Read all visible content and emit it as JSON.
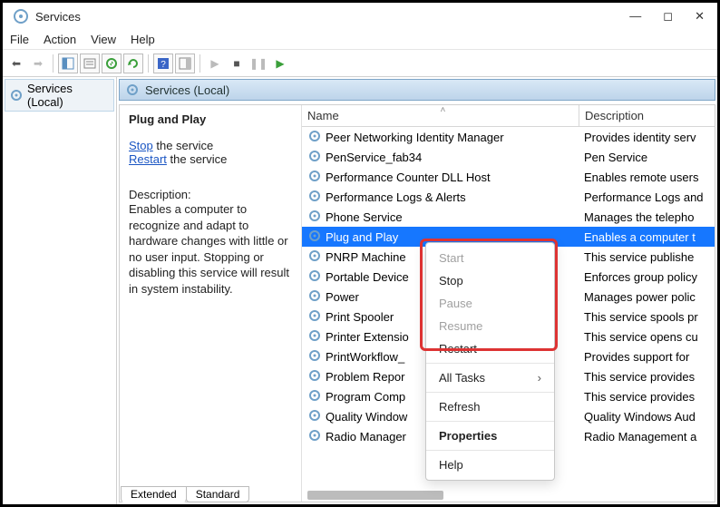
{
  "window": {
    "title": "Services"
  },
  "menubar": {
    "file": "File",
    "action": "Action",
    "view": "View",
    "help": "Help"
  },
  "tree": {
    "root": "Services (Local)"
  },
  "pane_header": "Services (Local)",
  "detail": {
    "service_name": "Plug and Play",
    "stop_link": "Stop",
    "stop_suffix": " the service",
    "restart_link": "Restart",
    "restart_suffix": " the service",
    "desc_label": "Description:",
    "description": "Enables a computer to recognize and adapt to hardware changes with little or no user input. Stopping or disabling this service will result in system instability."
  },
  "columns": {
    "name": "Name",
    "description": "Description"
  },
  "services": [
    {
      "name": "Peer Networking Identity Manager",
      "desc": "Provides identity serv"
    },
    {
      "name": "PenService_fab34",
      "desc": "Pen Service"
    },
    {
      "name": "Performance Counter DLL Host",
      "desc": "Enables remote users"
    },
    {
      "name": "Performance Logs & Alerts",
      "desc": "Performance Logs and"
    },
    {
      "name": "Phone Service",
      "desc": "Manages the telepho"
    },
    {
      "name": "Plug and Play",
      "desc": "Enables a computer t"
    },
    {
      "name": "PNRP Machine",
      "desc": "This service publishe"
    },
    {
      "name": "Portable Device",
      "desc": "Enforces group policy"
    },
    {
      "name": "Power",
      "desc": "Manages power polic"
    },
    {
      "name": "Print Spooler",
      "desc": "This service spools pr"
    },
    {
      "name": "Printer Extensio",
      "desc": "This service opens cu"
    },
    {
      "name": "PrintWorkflow_",
      "desc": "Provides support for"
    },
    {
      "name": "Problem Repor",
      "desc": "This service provides"
    },
    {
      "name": "Program Comp",
      "desc": "This service provides"
    },
    {
      "name": "Quality Window",
      "desc": "Quality Windows Aud"
    },
    {
      "name": "Radio Manager",
      "desc": "Radio Management a"
    }
  ],
  "selected_index": 5,
  "context_menu": {
    "start": "Start",
    "stop": "Stop",
    "pause": "Pause",
    "resume": "Resume",
    "restart": "Restart",
    "all_tasks": "All Tasks",
    "refresh": "Refresh",
    "properties": "Properties",
    "help": "Help"
  },
  "tabs": {
    "extended": "Extended",
    "standard": "Standard"
  }
}
